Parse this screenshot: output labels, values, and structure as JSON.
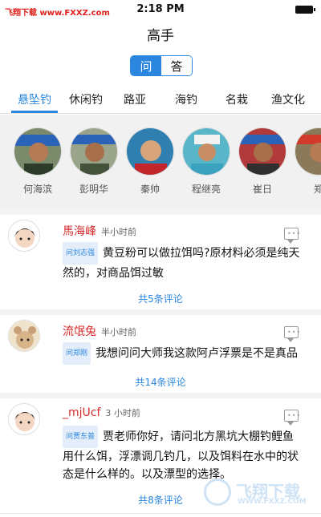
{
  "status_bar": {
    "watermark": "飞翔下载 www.FXXZ.com",
    "time": "2:18 PM"
  },
  "nav": {
    "title": "高手"
  },
  "segmented": {
    "ask": "问",
    "answer": "答"
  },
  "tabs": [
    {
      "label": "悬坠钓"
    },
    {
      "label": "休闲钓"
    },
    {
      "label": "路亚"
    },
    {
      "label": "海钓"
    },
    {
      "label": "名栽"
    },
    {
      "label": "渔文化"
    }
  ],
  "experts": [
    {
      "name": "何海滨"
    },
    {
      "name": "彭明华"
    },
    {
      "name": "秦帅"
    },
    {
      "name": "程继亮"
    },
    {
      "name": "崔日"
    },
    {
      "name": "郑"
    }
  ],
  "posts": [
    {
      "user": "馬海峰",
      "time": "半小时前",
      "tag": "问刘志强",
      "text": "黄豆粉可以做拉饵吗?原材料必须是纯天然的，对商品饵过敏",
      "comments": "共5条评论"
    },
    {
      "user": "流氓兔",
      "time": "半小时前",
      "tag": "问郑刚",
      "text": "我想问问大师我这款阿卢浮票是不是真品",
      "comments": "共14条评论"
    },
    {
      "user": "_mjUcf",
      "time": "3 小时前",
      "tag": "问贾东普",
      "text": "贾老师你好，请问北方黑坑大棚钓鲤鱼用什么饵，浮漂调几钓几，以及饵料在水中的状态是什么样的。以及漂型的选择。",
      "comments": "共8条评论"
    }
  ],
  "brand_watermark": {
    "name": "飞翔下载",
    "url": "WWW.FXXZ.COM"
  },
  "colors": {
    "accent": "#2a86de",
    "username": "#d6292a"
  }
}
